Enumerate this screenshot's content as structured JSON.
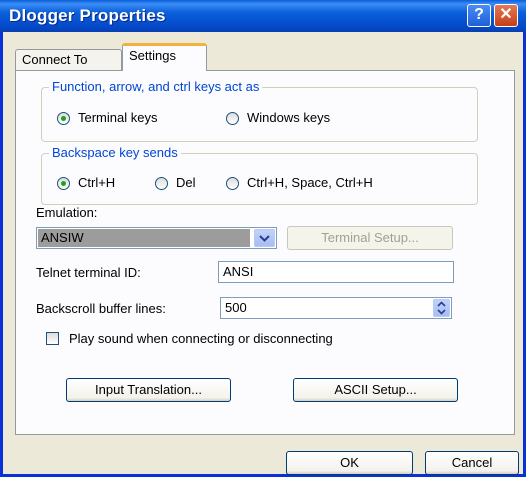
{
  "window": {
    "title": "Dlogger Properties",
    "help_glyph": "?",
    "close_glyph": "✕"
  },
  "tabs": [
    {
      "label": "Connect To",
      "selected": false
    },
    {
      "label": "Settings",
      "selected": true
    }
  ],
  "function_keys": {
    "group_label": "Function, arrow, and ctrl keys act as",
    "options": [
      {
        "label": "Terminal keys",
        "selected": true
      },
      {
        "label": "Windows keys",
        "selected": false
      }
    ]
  },
  "backspace": {
    "group_label": "Backspace key sends",
    "options": [
      {
        "label": "Ctrl+H",
        "selected": true
      },
      {
        "label": "Del",
        "selected": false
      },
      {
        "label": "Ctrl+H, Space, Ctrl+H",
        "selected": false
      }
    ]
  },
  "emulation": {
    "label": "Emulation:",
    "value": "ANSIW",
    "terminal_setup_label": "Terminal Setup..."
  },
  "telnet": {
    "label": "Telnet terminal ID:",
    "value": "ANSI"
  },
  "backscroll": {
    "label": "Backscroll buffer lines:",
    "value": "500"
  },
  "play_sound": {
    "label": "Play sound when connecting or disconnecting",
    "checked": false
  },
  "buttons": {
    "input_translation": "Input Translation...",
    "ascii_setup": "ASCII Setup...",
    "ok": "OK",
    "cancel": "Cancel"
  },
  "colors": {
    "titlebar": "#0a5fd8",
    "group_label": "#0046d5",
    "tab_highlight": "#f0b33c",
    "dialog_bg": "#ece9d8"
  }
}
